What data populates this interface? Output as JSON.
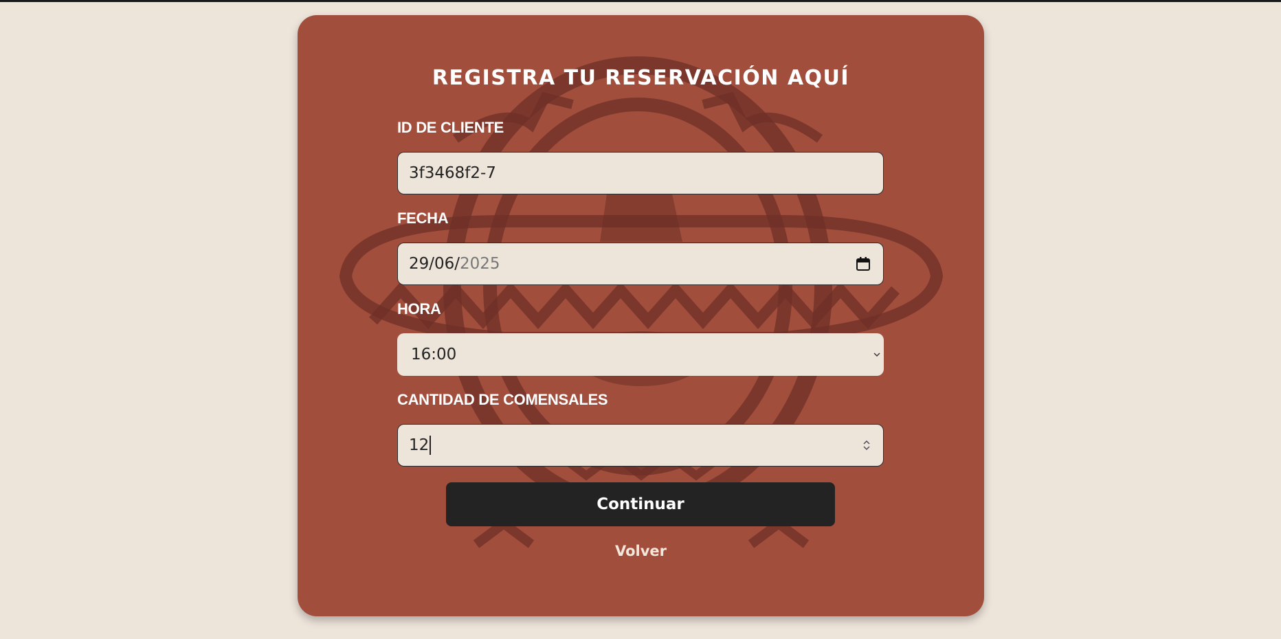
{
  "form": {
    "title": "REGISTRA TU RESERVACIÓN AQUÍ",
    "client_id": {
      "label": "ID DE CLIENTE",
      "value": "3f3468f2-7"
    },
    "date": {
      "label": "FECHA",
      "value_day_month": "29/06/",
      "value_year": "2025"
    },
    "time": {
      "label": "HORA",
      "selected": "16:00"
    },
    "guests": {
      "label": "CANTIDAD DE COMENSALES",
      "value": "12"
    },
    "continue_label": "Continuar",
    "back_label": "Volver"
  },
  "colors": {
    "page_background": "#ede4da",
    "card_background": "#a24e3c",
    "emblem": "#6e3027",
    "input_background": "#ede4da",
    "button_background": "#232323"
  },
  "icons": {
    "date": "calendar-icon",
    "time": "chevron-down-icon",
    "guests": "spinner-arrows-icon"
  }
}
